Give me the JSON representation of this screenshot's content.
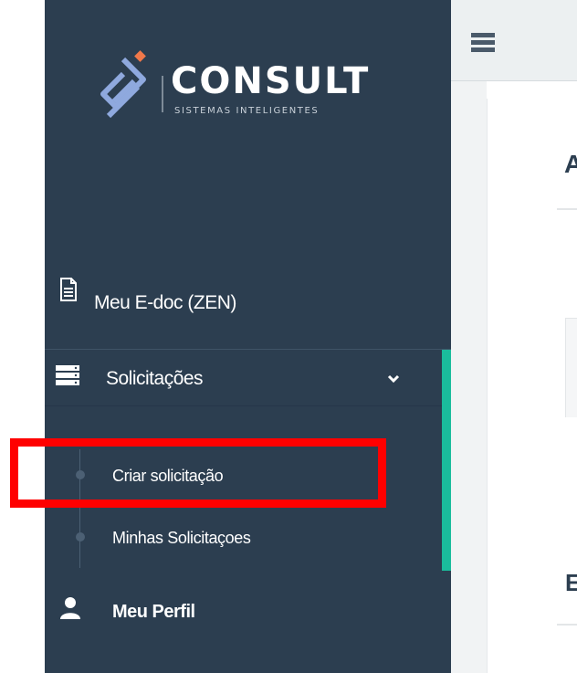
{
  "brand": {
    "name": "CONSULT",
    "tagline": "SISTEMAS INTELIGENTES",
    "colors": {
      "sidebar": "#2c3e50",
      "accent": "#1abc9c",
      "logo_dot": "#f0784a",
      "highlight": "#ff0000"
    }
  },
  "sidebar": {
    "items": [
      {
        "label": "Meu E-doc (ZEN)",
        "icon": "document-icon"
      },
      {
        "label": "Solicitações",
        "icon": "server-icon",
        "expanded": true,
        "children": [
          {
            "label": "Criar solicitação",
            "highlighted": true
          },
          {
            "label": "Minhas Solicitaçoes"
          }
        ]
      },
      {
        "label": "Meu Perfil",
        "icon": "user-icon"
      }
    ]
  },
  "topbar": {
    "menu_icon": "hamburger-icon"
  },
  "main": {
    "heading_1": "A",
    "heading_2": "E"
  }
}
